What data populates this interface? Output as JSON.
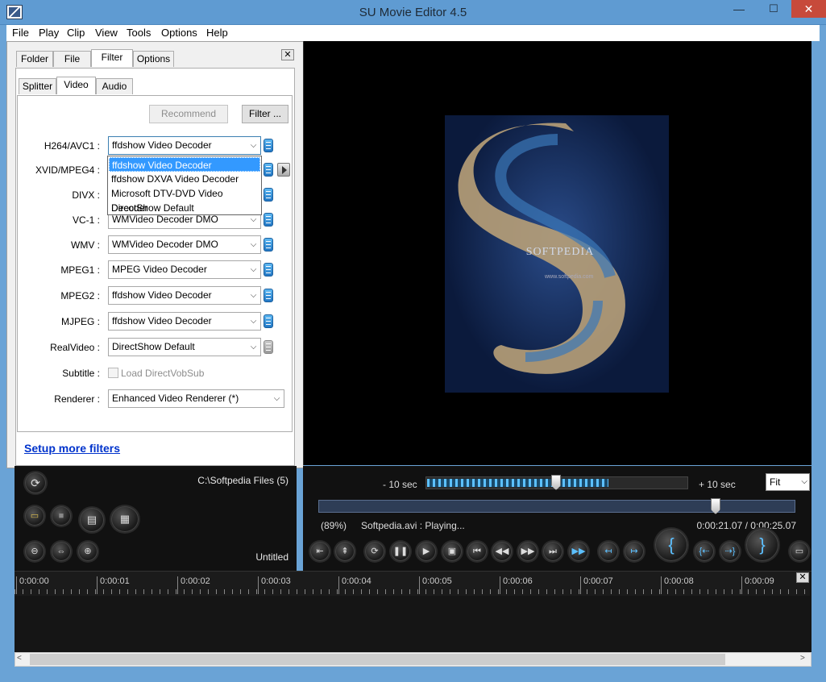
{
  "window": {
    "title": "SU Movie Editor 4.5",
    "min": "—",
    "max": "☐",
    "close": "✕"
  },
  "menu": [
    "File",
    "Play",
    "Clip",
    "View",
    "Tools",
    "Options",
    "Help"
  ],
  "tabs": {
    "folder": "Folder",
    "file": "File",
    "filter": "Filter",
    "options": "Options",
    "close": "✕"
  },
  "subtabs": {
    "splitter": "Splitter",
    "video": "Video",
    "audio": "Audio"
  },
  "buttons": {
    "recommend": "Recommend",
    "filter": "Filter ..."
  },
  "rows": [
    {
      "label": "H264/AVC1 :",
      "value": "ffdshow Video Decoder"
    },
    {
      "label": "XVID/MPEG4 :",
      "value": ""
    },
    {
      "label": "DIVX :",
      "value": ""
    },
    {
      "label": "VC-1 :",
      "value": "WMVideo Decoder DMO"
    },
    {
      "label": "WMV :",
      "value": "WMVideo Decoder DMO"
    },
    {
      "label": "MPEG1 :",
      "value": "MPEG Video Decoder"
    },
    {
      "label": "MPEG2 :",
      "value": "ffdshow Video Decoder"
    },
    {
      "label": "MJPEG :",
      "value": "ffdshow Video Decoder"
    },
    {
      "label": "RealVideo :",
      "value": "DirectShow Default"
    }
  ],
  "dropdown": [
    "ffdshow Video Decoder",
    "ffdshow DXVA Video Decoder",
    "Microsoft DTV-DVD Video Decoder",
    "DirectShow Default"
  ],
  "subtitle": {
    "label": "Subtitle :",
    "checkbox": "Load DirectVobSub"
  },
  "renderer": {
    "label": "Renderer :",
    "value": "Enhanced Video Renderer (*)"
  },
  "setup_link": "Setup more filters",
  "left_bottom": {
    "path": "C:\\Softpedia Files (5)",
    "project": "Untitled"
  },
  "video": {
    "watermark": "SOFTPEDIA",
    "url": "www.softpedia.com"
  },
  "player": {
    "minus": "- 10 sec",
    "plus": "+ 10 sec",
    "zoom": "Fit",
    "percent": "(89%)",
    "status": "Softpedia.avi : Playing...",
    "time": "0:00:21.07 / 0:00:25.07",
    "jog_level": 0.5,
    "seek_level": 0.84
  },
  "timeline": {
    "ticks": [
      "0:00:00",
      "0:00:01",
      "0:00:02",
      "0:00:03",
      "0:00:04",
      "0:00:05",
      "0:00:06",
      "0:00:07",
      "0:00:08",
      "0:00:09"
    ],
    "close": "✕"
  },
  "scroll": {
    "left": "<",
    "right": ">"
  },
  "arrow": "⌵"
}
